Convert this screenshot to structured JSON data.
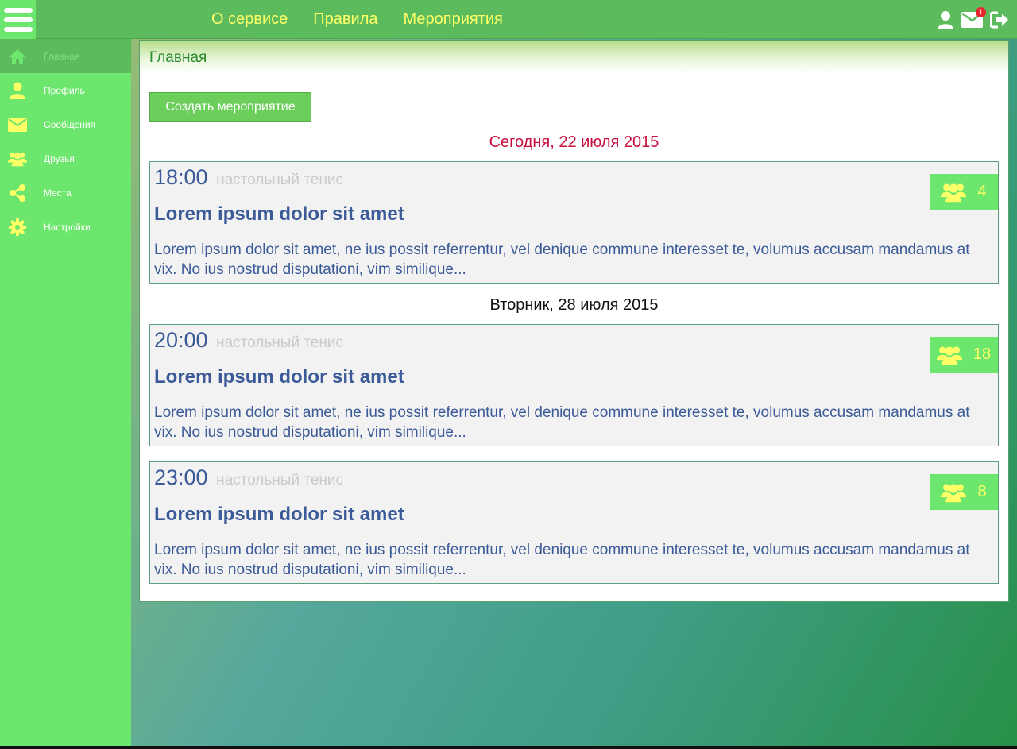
{
  "topnav": {
    "items": [
      {
        "label": "О сервисе"
      },
      {
        "label": "Правила"
      },
      {
        "label": "Мероприятия"
      }
    ],
    "mail_badge": "1"
  },
  "sidebar": {
    "items": [
      {
        "label": "Главная",
        "icon": "home-icon",
        "active": true
      },
      {
        "label": "Профиль",
        "icon": "user-icon"
      },
      {
        "label": "Сообщения",
        "icon": "envelope-icon"
      },
      {
        "label": "Друзья",
        "icon": "users-icon"
      },
      {
        "label": "Места",
        "icon": "share-icon"
      },
      {
        "label": "Настройки",
        "icon": "gear-icon"
      }
    ]
  },
  "main": {
    "title": "Главная",
    "create_button": "Создать мероприятие",
    "groups": [
      {
        "date": "Сегодня, 22 июля 2015",
        "events": [
          {
            "time": "18:00",
            "sport": "настольный тенис",
            "title": "Lorem ipsum dolor sit amet",
            "description": "Lorem ipsum dolor sit amet, ne ius possit referrentur, vel denique commune interesset te, volumus accusam mandamus at vix. No ius nostrud disputationi, vim similique...",
            "participants": "4"
          }
        ]
      },
      {
        "date": "Вторник, 28 июля 2015",
        "events": [
          {
            "time": "20:00",
            "sport": "настольный тенис",
            "title": "Lorem ipsum dolor sit amet",
            "description": "Lorem ipsum dolor sit amet, ne ius possit referrentur, vel denique commune interesset te, volumus accusam mandamus at vix. No ius nostrud disputationi, vim similique...",
            "participants": "18"
          },
          {
            "time": "23:00",
            "sport": "настольный тенис",
            "title": "Lorem ipsum dolor sit amet",
            "description": "Lorem ipsum dolor sit amet, ne ius possit referrentur, vel denique commune interesset te, volumus accusam mandamus at vix. No ius nostrud disputationi, vim similique...",
            "participants": "8"
          }
        ]
      }
    ]
  },
  "colors": {
    "topbar": "#5cbb5c",
    "sidebar": "#6ce66c",
    "nav_text": "#ffff66",
    "today": "#c8103e",
    "event_text": "#3b5a98"
  }
}
